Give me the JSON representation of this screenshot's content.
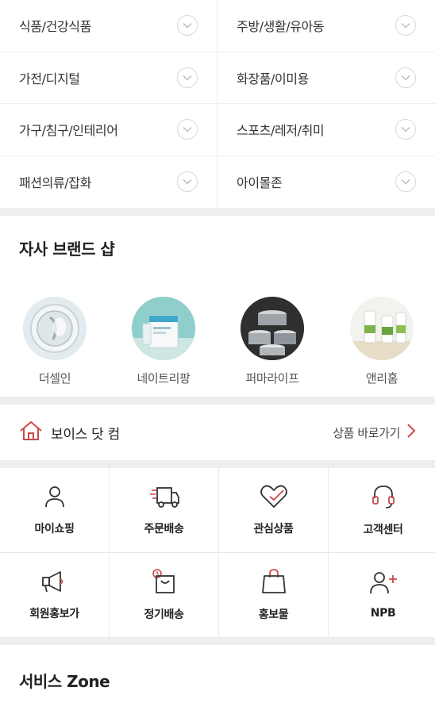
{
  "categories": [
    {
      "label": "식품/건강식품"
    },
    {
      "label": "주방/생활/유아동"
    },
    {
      "label": "가전/디지털"
    },
    {
      "label": "화장품/이미용"
    },
    {
      "label": "가구/침구/인테리어"
    },
    {
      "label": "스포츠/레저/취미"
    },
    {
      "label": "패션의류/잡화"
    },
    {
      "label": "아이몰존"
    }
  ],
  "brand_shop": {
    "title": "자사 브랜드 샵",
    "brands": [
      {
        "name": "더셀인",
        "logo": "round-device-image"
      },
      {
        "name": "네이트리팡",
        "logo": "supplement-box-image"
      },
      {
        "name": "퍼마라이프",
        "logo": "cookware-set-image"
      },
      {
        "name": "앤리홈",
        "logo": "cleaning-bottles-image"
      }
    ]
  },
  "voice_banner": {
    "title": "보이스 닷 컴",
    "link_label": "상품 바로가기",
    "accent_color": "#c94b4b"
  },
  "menu": [
    {
      "label": "마이쇼핑",
      "icon": "person-icon"
    },
    {
      "label": "주문배송",
      "icon": "truck-icon"
    },
    {
      "label": "관심상품",
      "icon": "heart-icon"
    },
    {
      "label": "고객센터",
      "icon": "headset-icon"
    },
    {
      "label": "회원홍보가",
      "icon": "megaphone-icon"
    },
    {
      "label": "정기배송",
      "icon": "calendar-bag-icon"
    },
    {
      "label": "홍보물",
      "icon": "shopping-bag-icon"
    },
    {
      "label": "NPB",
      "icon": "add-person-icon"
    }
  ],
  "service_zone": {
    "title": "서비스 Zone"
  }
}
